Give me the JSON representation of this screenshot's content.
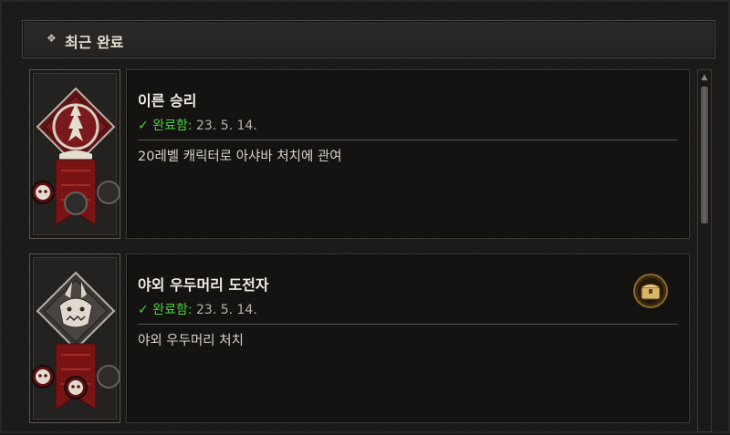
{
  "panel": {
    "title": "최근 완료",
    "title_icon": "diamond-cluster-icon"
  },
  "achievements": [
    {
      "title": "이른 승리",
      "check": "✓",
      "status_label": "완료함:",
      "date": "23. 5. 14.",
      "description": "20레벨 캐릭터로 아샤바 처치에 관여",
      "emblem_icon": "dragon-sun-emblem-icon",
      "has_reward": false
    },
    {
      "title": "야외 우두머리 도전자",
      "check": "✓",
      "status_label": "완료함:",
      "date": "23. 5. 14.",
      "description": "야외 우두머리 처치",
      "emblem_icon": "dragon-head-emblem-icon",
      "has_reward": true,
      "reward_icon": "treasure-chest-icon"
    }
  ],
  "colors": {
    "completed_green": "#4bd13e",
    "emblem_red": "#8e1c1c",
    "reward_gold": "#c99a3c"
  }
}
